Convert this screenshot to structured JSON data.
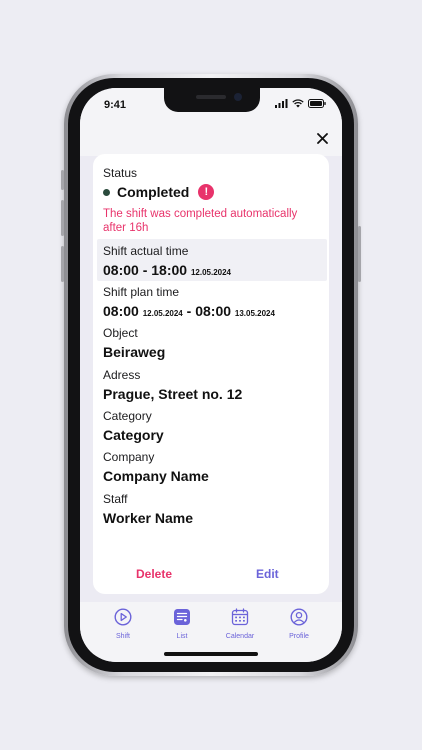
{
  "statusbar": {
    "time": "9:41"
  },
  "details": {
    "status_label": "Status",
    "status_value": "Completed",
    "alert_symbol": "!",
    "warning": "The shift was completed automatically after 16h",
    "actual_label": "Shift actual time",
    "actual_time": "08:00 - 18:00",
    "actual_date": "12.05.2024",
    "plan_label": "Shift plan time",
    "plan_start_time": "08:00",
    "plan_start_date": "12.05.2024",
    "plan_separator": "-",
    "plan_end_time": "08:00",
    "plan_end_date": "13.05.2024",
    "object_label": "Object",
    "object_value": "Beiraweg",
    "address_label": "Adress",
    "address_value": "Prague, Street no. 12",
    "category_label": "Category",
    "category_value": "Category",
    "company_label": "Company",
    "company_value": "Company Name",
    "staff_label": "Staff",
    "staff_value": "Worker Name"
  },
  "actions": {
    "delete": "Delete",
    "edit": "Edit"
  },
  "tabs": [
    {
      "label": "Shift",
      "icon": "play-icon"
    },
    {
      "label": "List",
      "icon": "list-icon",
      "active": true
    },
    {
      "label": "Calendar",
      "icon": "calendar-icon"
    },
    {
      "label": "Profile",
      "icon": "profile-icon"
    }
  ],
  "colors": {
    "accent": "#6b63d9",
    "danger": "#e8336b",
    "status_dot": "#2a4a3c",
    "background": "#ecebf3"
  }
}
